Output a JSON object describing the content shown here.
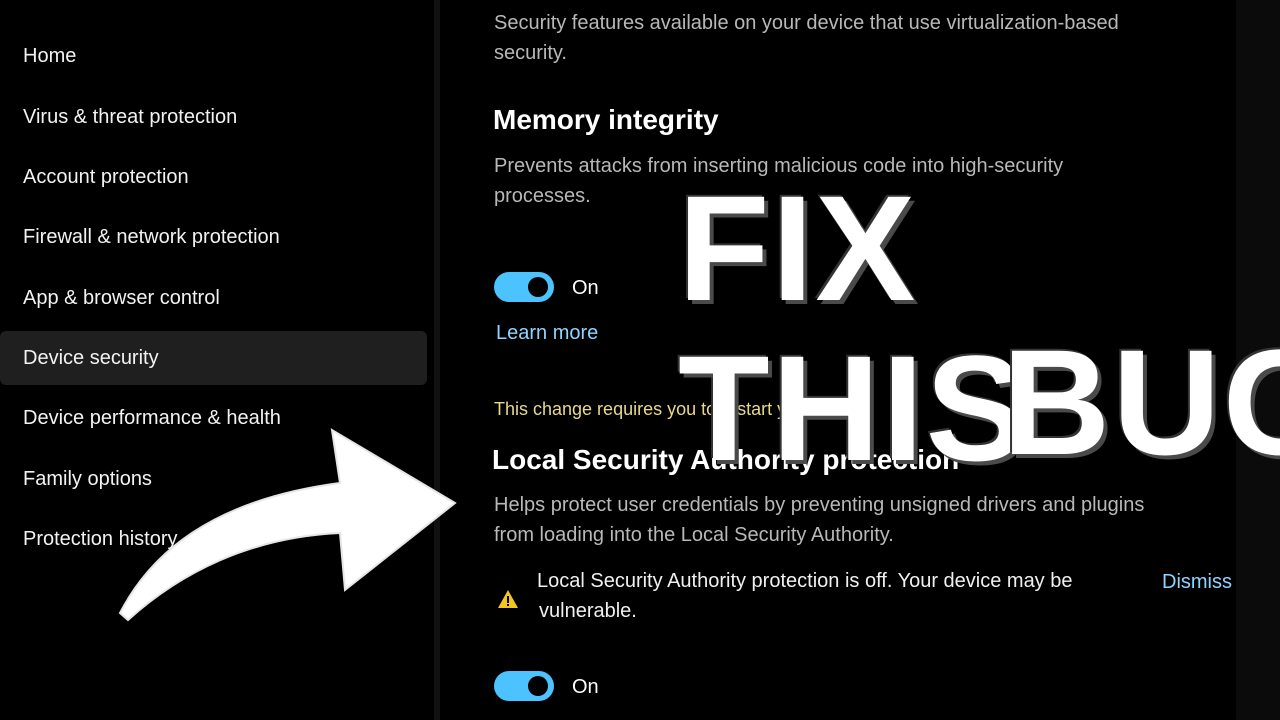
{
  "sidebar": {
    "items": [
      {
        "label": "Home"
      },
      {
        "label": "Virus & threat protection"
      },
      {
        "label": "Account protection"
      },
      {
        "label": "Firewall & network protection"
      },
      {
        "label": "App & browser control"
      },
      {
        "label": "Device security",
        "active": true
      },
      {
        "label": "Device performance & health"
      },
      {
        "label": "Family options"
      },
      {
        "label": "Protection history"
      }
    ]
  },
  "main": {
    "intro_line1": "Security features available on your device that use virtualization-based",
    "intro_line2": "security.",
    "memory": {
      "title": "Memory integrity",
      "desc_line1": "Prevents attacks from inserting malicious code into high-security",
      "desc_line2": "processes.",
      "toggle_state": "On",
      "learn_more": "Learn more",
      "restart_notice": "This change requires you to restart your device."
    },
    "lsa": {
      "title": "Local Security Authority protection",
      "desc_line1": "Helps protect user credentials by preventing unsigned drivers and plugins",
      "desc_line2": "from loading into the Local Security Authority.",
      "warning_line1": "Local Security Authority protection is off. Your device may be",
      "warning_line2": "vulnerable.",
      "dismiss": "Dismiss",
      "toggle_state": "On"
    }
  },
  "overlay": {
    "line1": "FIX THIS",
    "line2": "BUG"
  },
  "colors": {
    "accent": "#4cc2ff",
    "link": "#8fd3ff",
    "notice": "#e8d88a",
    "warning": "#f2c522",
    "active_bg": "#1f1f1f"
  },
  "icons": {
    "warning": "warning-icon",
    "arrow": "arrow-graphic"
  }
}
